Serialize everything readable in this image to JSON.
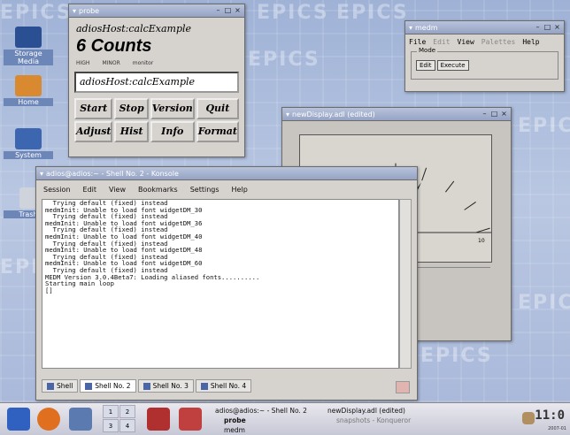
{
  "desktop": {
    "background_text": "EPICS",
    "icons": [
      {
        "label": "Storage Media"
      },
      {
        "label": "Home"
      },
      {
        "label": "System"
      },
      {
        "label": "Trash"
      }
    ]
  },
  "probe": {
    "title": "probe",
    "host": "adiosHost:calcExample",
    "counts": "6 Counts",
    "flags": [
      "HIGH",
      "MINOR",
      "monitor"
    ],
    "input_value": "adiosHost:calcExample",
    "buttons": [
      "Start",
      "Stop",
      "Version",
      "Quit",
      "Adjust",
      "Hist",
      "Info",
      "Format"
    ]
  },
  "medm": {
    "title": "medm",
    "menu": [
      {
        "label": "File",
        "enabled": true
      },
      {
        "label": "Edit",
        "enabled": false
      },
      {
        "label": "View",
        "enabled": true
      },
      {
        "label": "Palettes",
        "enabled": false
      },
      {
        "label": "Help",
        "enabled": true
      }
    ],
    "mode_label": "Mode",
    "mode_buttons": [
      "Edit",
      "Execute"
    ]
  },
  "newdisplay": {
    "title": "newDisplay.adl (edited)",
    "meter": {
      "min_label": "0",
      "max_label": "10",
      "value": 6
    }
  },
  "konsole": {
    "title": "adios@adios:~ - Shell No. 2 - Konsole",
    "menu": [
      "Session",
      "Edit",
      "View",
      "Bookmarks",
      "Settings",
      "Help"
    ],
    "lines": [
      "  Trying default (fixed) instead",
      "",
      "medmInit: Unable to load font widgetDM_30",
      "  Trying default (fixed) instead",
      "",
      "medmInit: Unable to load font widgetDM_36",
      "  Trying default (fixed) instead",
      "",
      "medmInit: Unable to load font widgetDM_40",
      "  Trying default (fixed) instead",
      "",
      "medmInit: Unable to load font widgetDM_48",
      "  Trying default (fixed) instead",
      "",
      "medmInit: Unable to load font widgetDM_60",
      "  Trying default (fixed) instead",
      "MEDM Version 3.0.4Beta7: Loading aliased fonts..........",
      "",
      "Starting main loop",
      "[]"
    ],
    "tabs": [
      "Shell",
      "Shell No. 2",
      "Shell No. 3",
      "Shell No. 4"
    ]
  },
  "taskbar": {
    "pager": [
      "1",
      "2",
      "3",
      "4"
    ],
    "tasks": [
      "adios@adios:~ - Shell No. 2",
      "probe",
      "medm",
      "newDisplay.adl (edited)",
      "snapshots - Konqueror"
    ],
    "clock": "11:0",
    "clock_sub": "2007-01"
  },
  "colors": {
    "desktop": "#a9b9d8",
    "window_face": "#d6d3ce",
    "needle": "#000000"
  }
}
